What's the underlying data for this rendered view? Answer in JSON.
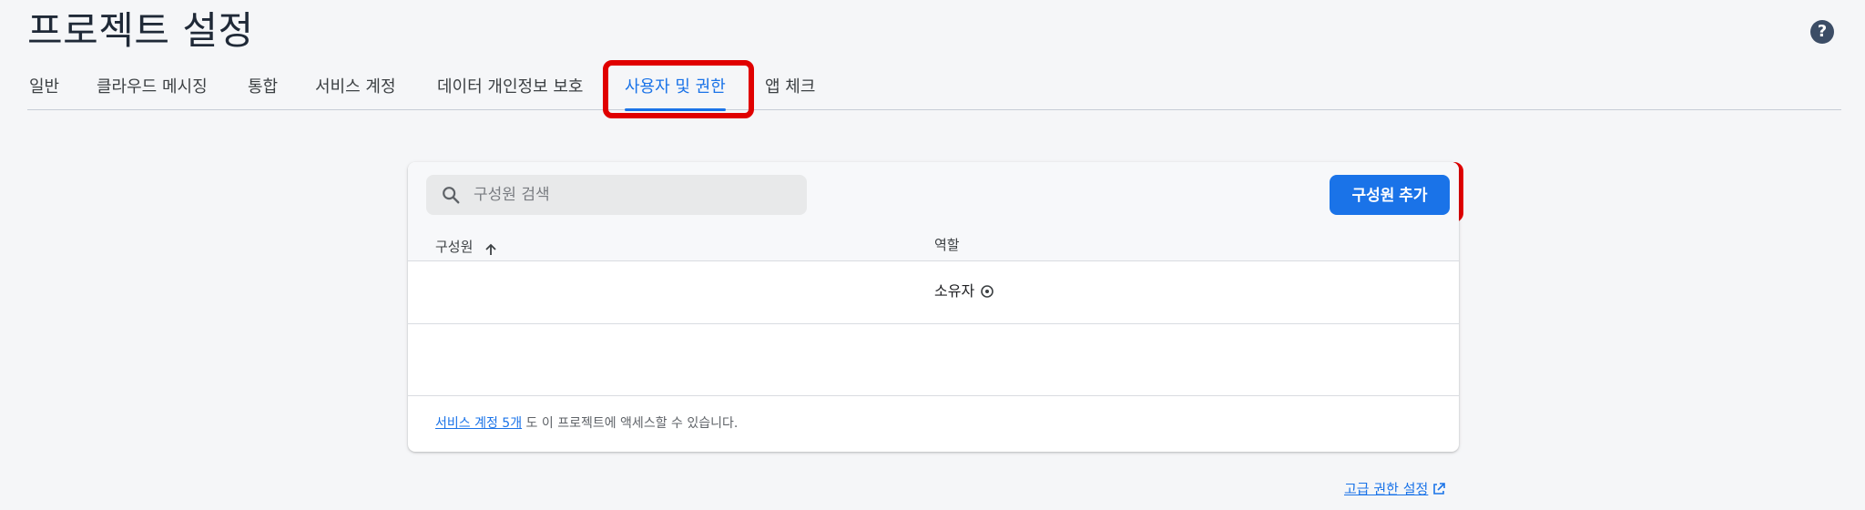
{
  "header": {
    "title": "프로젝트 설정",
    "help_symbol": "?"
  },
  "tabs": [
    {
      "label": "일반"
    },
    {
      "label": "클라우드 메시징"
    },
    {
      "label": "통합"
    },
    {
      "label": "서비스 계정"
    },
    {
      "label": "데이터 개인정보 보호"
    },
    {
      "label": "사용자 및 권한"
    },
    {
      "label": "앱 체크"
    }
  ],
  "active_tab": "사용자 및 권한",
  "search": {
    "placeholder": "구성원 검색",
    "value": ""
  },
  "add_member_button": {
    "label": "구성원 추가"
  },
  "table": {
    "columns": [
      "구성원",
      "역할"
    ],
    "sorted_column": "구성원",
    "sort_direction": "ascending",
    "rows": [
      {
        "member": "",
        "role": "소유자"
      },
      {
        "member": "",
        "role": ""
      }
    ]
  },
  "footer": {
    "link_text": "서비스 계정 5개",
    "text": "도 이 프로젝트에 액세스할 수 있습니다."
  },
  "advanced_permissions_link": {
    "label": "고급 권한 설정"
  },
  "colors": {
    "accent": "#1a73e8",
    "highlight": "#e00000",
    "background": "#f5f6f8"
  }
}
